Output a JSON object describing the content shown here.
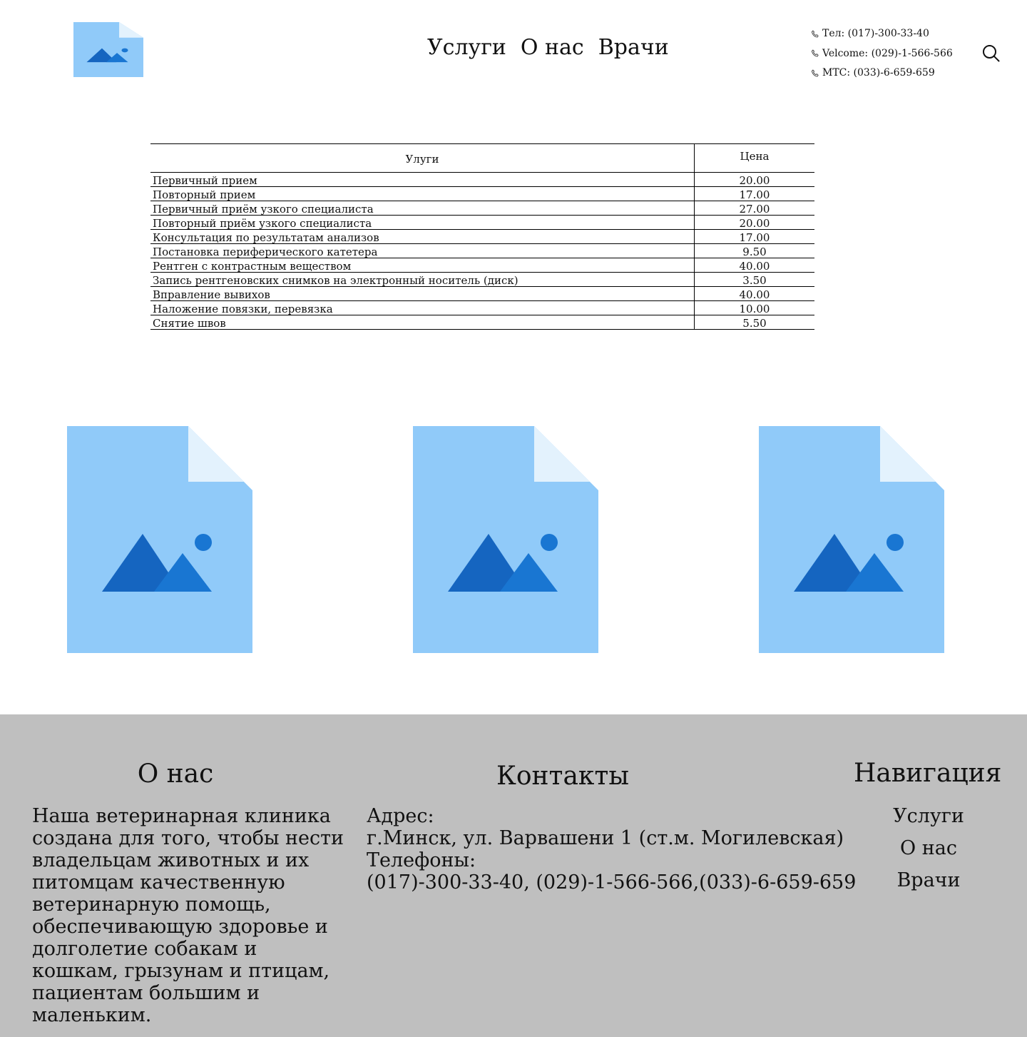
{
  "header": {
    "logo_icon": "image-placeholder-icon",
    "nav": [
      {
        "label": "Услуги"
      },
      {
        "label": "О нас"
      },
      {
        "label": "Врачи"
      }
    ],
    "phones": [
      {
        "icon": "phone-icon",
        "text": "Тел: (017)-300-33-40"
      },
      {
        "icon": "phone-icon",
        "text": "Velcome: (029)-1-566-566"
      },
      {
        "icon": "phone-icon",
        "text": "МТС: (033)-6-659-659"
      }
    ],
    "search_icon": "search-icon"
  },
  "price_table": {
    "headers": {
      "service": "Улуги",
      "price": "Цена"
    },
    "rows": [
      {
        "service": "Первичный прием",
        "price": "20.00"
      },
      {
        "service": "Повторный прием",
        "price": "17.00"
      },
      {
        "service": "Первичный приём узкого специалиста",
        "price": "27.00"
      },
      {
        "service": "Повторный приём узкого специалиста",
        "price": "20.00"
      },
      {
        "service": "Консультация по результатам анализов",
        "price": "17.00"
      },
      {
        "service": "Постановка периферического катетера",
        "price": "9.50"
      },
      {
        "service": "Рентген с контрастным веществом",
        "price": "40.00"
      },
      {
        "service": "Запись рентгеновских снимков на электронный носитель (диск)",
        "price": "3.50"
      },
      {
        "service": "Вправление вывихов",
        "price": "40.00"
      },
      {
        "service": "Наложение повязки, перевязка",
        "price": "10.00"
      },
      {
        "service": "Снятие швов",
        "price": "5.50"
      }
    ]
  },
  "gallery": [
    {
      "icon": "image-placeholder-icon"
    },
    {
      "icon": "image-placeholder-icon"
    },
    {
      "icon": "image-placeholder-icon"
    }
  ],
  "footer": {
    "about": {
      "title": "О нас",
      "text": "Наша ветеринарная клиника создана для того, чтобы нести владельцам животных и их питомцам качественную ветеринарную помощь, обеспечивающую здоровье и долголетие собакам и кошкам, грызунам и птицам, пациентам большим и маленьким."
    },
    "contacts": {
      "title": "Контакты",
      "address_label": "Адрес:",
      "address": "г.Минск, ул. Варвашени 1 (ст.м. Могилевская)",
      "phones_label": "Телефоны:",
      "phones": "(017)-300-33-40, (029)-1-566-566,(033)-6-659-659"
    },
    "navigation": {
      "title": "Навигация",
      "items": [
        {
          "label": "Услуги"
        },
        {
          "label": "О нас"
        },
        {
          "label": "Врачи"
        }
      ]
    }
  },
  "colors": {
    "placeholder_page": "#90CAF9",
    "placeholder_fold": "#E3F2FD",
    "placeholder_mountain_dark": "#1565C0",
    "placeholder_mountain_light": "#1976D2",
    "footer_bg": "#BFBFBF"
  }
}
